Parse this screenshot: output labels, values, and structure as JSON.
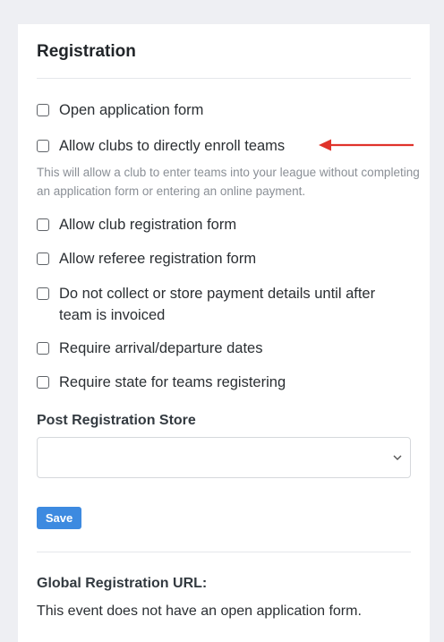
{
  "card": {
    "title": "Registration"
  },
  "options": [
    {
      "label": "Open application form",
      "checked": false
    },
    {
      "label": "Allow clubs to directly enroll teams",
      "checked": false
    },
    {
      "label": "Allow club registration form",
      "checked": false
    },
    {
      "label": "Allow referee registration form",
      "checked": false
    },
    {
      "label": "Do not collect or store payment details until after team is invoiced",
      "checked": false
    },
    {
      "label": "Require arrival/departure dates",
      "checked": false
    },
    {
      "label": "Require state for teams registering",
      "checked": false
    }
  ],
  "help": {
    "direct_enroll": "This will allow a club to enter teams into your league without completing an application form or entering an online payment."
  },
  "store": {
    "label": "Post Registration Store",
    "selected": ""
  },
  "actions": {
    "save_label": "Save"
  },
  "global_url": {
    "label": "Global Registration URL:",
    "value": "This event does not have an open application form."
  },
  "colors": {
    "accent": "#3d8ae0",
    "arrow": "#e0332b"
  }
}
